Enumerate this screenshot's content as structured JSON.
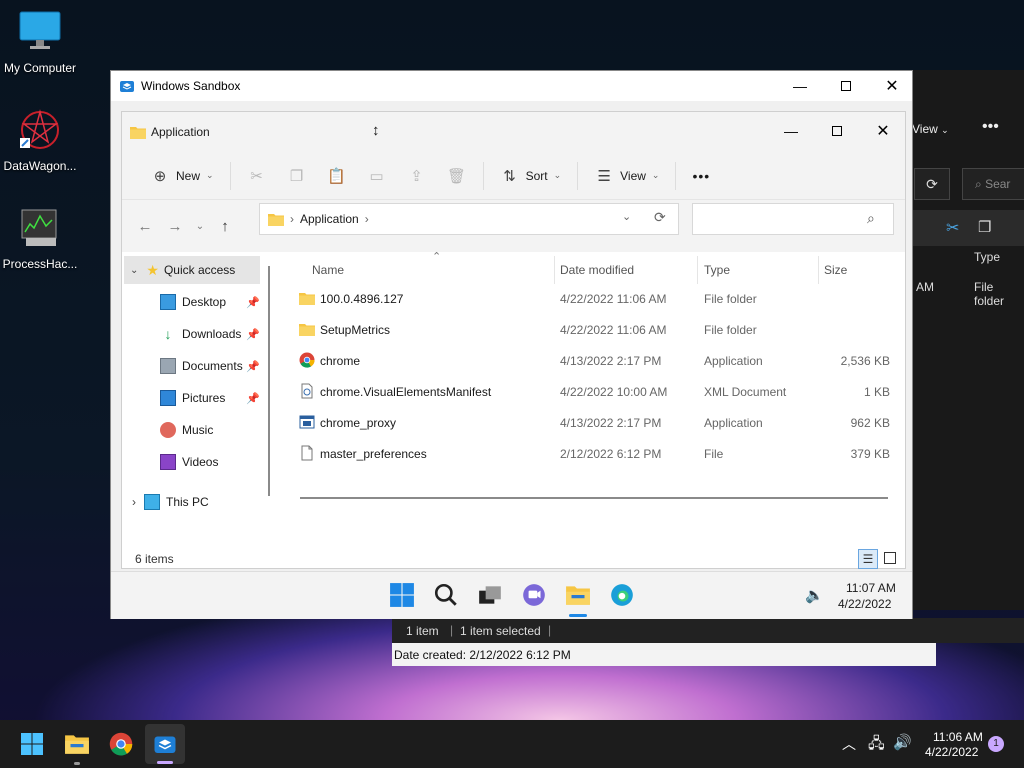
{
  "desktop": {
    "icons": [
      {
        "label": "My Computer"
      },
      {
        "label": "DataWagon..."
      },
      {
        "label": "ProcessHac..."
      }
    ]
  },
  "background_window": {
    "view_label": "View",
    "type_header": "Type",
    "row_time": "AM",
    "row_type": "File folder",
    "search_placeholder": "Sear"
  },
  "background_status": {
    "item_count": "1 item",
    "selected": "1 item selected",
    "date_created": "Date created: 2/12/2022 6:12 PM"
  },
  "sandbox": {
    "title": "Windows Sandbox"
  },
  "explorer": {
    "title": "Application",
    "toolbar": {
      "new_label": "New",
      "sort_label": "Sort",
      "view_label": "View"
    },
    "address": {
      "folder": "Application"
    },
    "nav": {
      "quick_access": "Quick access",
      "items": [
        {
          "label": "Desktop",
          "pinned": true
        },
        {
          "label": "Downloads",
          "pinned": true
        },
        {
          "label": "Documents",
          "pinned": true
        },
        {
          "label": "Pictures",
          "pinned": true
        },
        {
          "label": "Music",
          "pinned": false
        },
        {
          "label": "Videos",
          "pinned": false
        }
      ],
      "this_pc": "This PC"
    },
    "columns": {
      "name": "Name",
      "date": "Date modified",
      "type": "Type",
      "size": "Size"
    },
    "files": [
      {
        "name": "100.0.4896.127",
        "date": "4/22/2022 11:06 AM",
        "type": "File folder",
        "size": "",
        "icon": "folder-icon"
      },
      {
        "name": "SetupMetrics",
        "date": "4/22/2022 11:06 AM",
        "type": "File folder",
        "size": "",
        "icon": "folder-icon"
      },
      {
        "name": "chrome",
        "date": "4/13/2022 2:17 PM",
        "type": "Application",
        "size": "2,536 KB",
        "icon": "chrome-icon"
      },
      {
        "name": "chrome.VisualElementsManifest",
        "date": "4/22/2022 10:00 AM",
        "type": "XML Document",
        "size": "1 KB",
        "icon": "xml-icon"
      },
      {
        "name": "chrome_proxy",
        "date": "4/13/2022 2:17 PM",
        "type": "Application",
        "size": "962 KB",
        "icon": "app-icon"
      },
      {
        "name": "master_preferences",
        "date": "2/12/2022 6:12 PM",
        "type": "File",
        "size": "379 KB",
        "icon": "file-icon"
      }
    ],
    "status": "6 items"
  },
  "sandbox_taskbar": {
    "time": "11:07 AM",
    "date": "4/22/2022"
  },
  "taskbar": {
    "time": "11:06 AM",
    "date": "4/22/2022",
    "notification_count": "1"
  }
}
